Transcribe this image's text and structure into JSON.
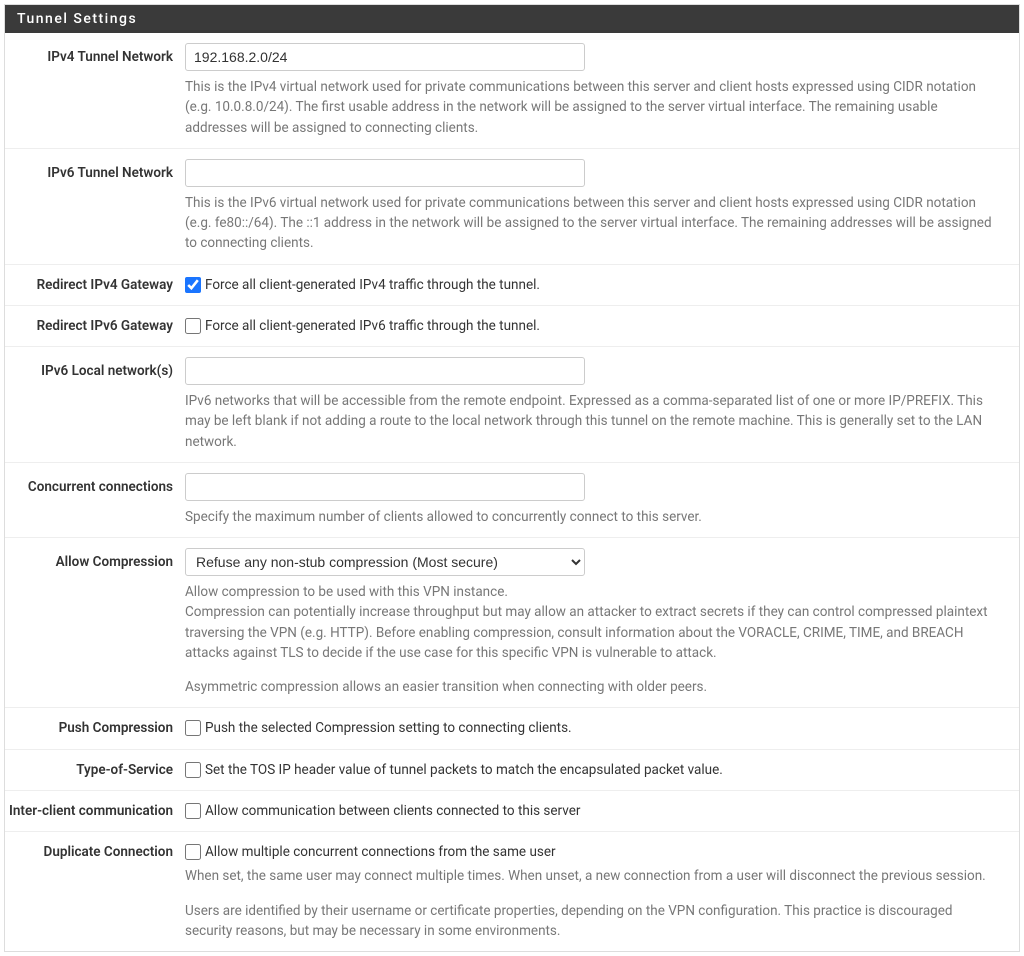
{
  "panel": {
    "title": "Tunnel Settings"
  },
  "fields": {
    "ipv4_tunnel_network": {
      "label": "IPv4 Tunnel Network",
      "value": "192.168.2.0/24",
      "help": "This is the IPv4 virtual network used for private communications between this server and client hosts expressed using CIDR notation (e.g. 10.0.8.0/24). The first usable address in the network will be assigned to the server virtual interface. The remaining usable addresses will be assigned to connecting clients."
    },
    "ipv6_tunnel_network": {
      "label": "IPv6 Tunnel Network",
      "value": "",
      "help": "This is the IPv6 virtual network used for private communications between this server and client hosts expressed using CIDR notation (e.g. fe80::/64). The ::1 address in the network will be assigned to the server virtual interface. The remaining addresses will be assigned to connecting clients."
    },
    "redirect_ipv4_gateway": {
      "label": "Redirect IPv4 Gateway",
      "checked": true,
      "checkbox_label": "Force all client-generated IPv4 traffic through the tunnel."
    },
    "redirect_ipv6_gateway": {
      "label": "Redirect IPv6 Gateway",
      "checked": false,
      "checkbox_label": "Force all client-generated IPv6 traffic through the tunnel."
    },
    "ipv6_local_networks": {
      "label": "IPv6 Local network(s)",
      "value": "",
      "help": "IPv6 networks that will be accessible from the remote endpoint. Expressed as a comma-separated list of one or more IP/PREFIX. This may be left blank if not adding a route to the local network through this tunnel on the remote machine. This is generally set to the LAN network."
    },
    "concurrent_connections": {
      "label": "Concurrent connections",
      "value": "",
      "help": "Specify the maximum number of clients allowed to concurrently connect to this server."
    },
    "allow_compression": {
      "label": "Allow Compression",
      "selected": "Refuse any non-stub compression (Most secure)",
      "help1": "Allow compression to be used with this VPN instance.",
      "help2": "Compression can potentially increase throughput but may allow an attacker to extract secrets if they can control compressed plaintext traversing the VPN (e.g. HTTP). Before enabling compression, consult information about the VORACLE, CRIME, TIME, and BREACH attacks against TLS to decide if the use case for this specific VPN is vulnerable to attack.",
      "help3": "Asymmetric compression allows an easier transition when connecting with older peers."
    },
    "push_compression": {
      "label": "Push Compression",
      "checked": false,
      "checkbox_label": "Push the selected Compression setting to connecting clients."
    },
    "type_of_service": {
      "label": "Type-of-Service",
      "checked": false,
      "checkbox_label": "Set the TOS IP header value of tunnel packets to match the encapsulated packet value."
    },
    "inter_client_communication": {
      "label": "Inter-client communication",
      "checked": false,
      "checkbox_label": "Allow communication between clients connected to this server"
    },
    "duplicate_connection": {
      "label": "Duplicate Connection",
      "checked": false,
      "checkbox_label": "Allow multiple concurrent connections from the same user",
      "help1": "When set, the same user may connect multiple times. When unset, a new connection from a user will disconnect the previous session.",
      "help2": "Users are identified by their username or certificate properties, depending on the VPN configuration. This practice is discouraged security reasons, but may be necessary in some environments."
    }
  }
}
